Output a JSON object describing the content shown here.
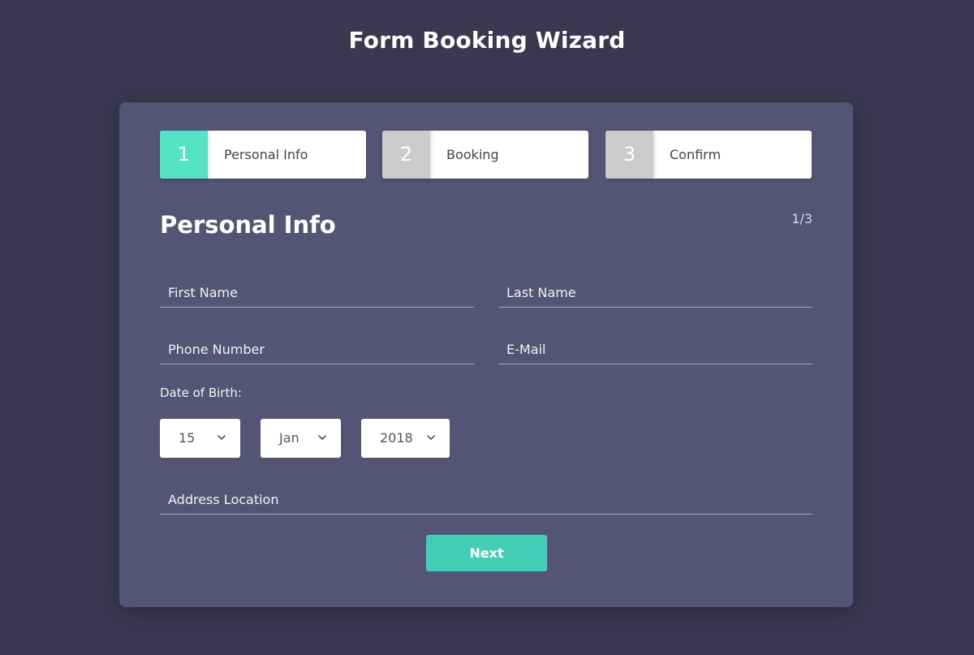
{
  "page_title": "Form Booking Wizard",
  "steps": [
    {
      "number": "1",
      "label": "Personal Info"
    },
    {
      "number": "2",
      "label": "Booking"
    },
    {
      "number": "3",
      "label": "Confirm"
    }
  ],
  "active_step": 1,
  "section": {
    "title": "Personal Info",
    "counter": "1/3"
  },
  "fields": {
    "first_name": {
      "placeholder": "First Name",
      "value": ""
    },
    "last_name": {
      "placeholder": "Last Name",
      "value": ""
    },
    "phone": {
      "placeholder": "Phone Number",
      "value": ""
    },
    "email": {
      "placeholder": "E-Mail",
      "value": ""
    },
    "address": {
      "placeholder": "Address Location",
      "value": ""
    }
  },
  "dob": {
    "label": "Date of Birth:",
    "day": "15",
    "month": "Jan",
    "year": "2018"
  },
  "next_label": "Next",
  "colors": {
    "background": "#393850",
    "card": "#545475",
    "accent": "#55e3c6",
    "button": "#43cdb7",
    "inactive_step": "#cbcbcb"
  },
  "icons": {
    "select_arrow": "chevron-down-icon"
  }
}
